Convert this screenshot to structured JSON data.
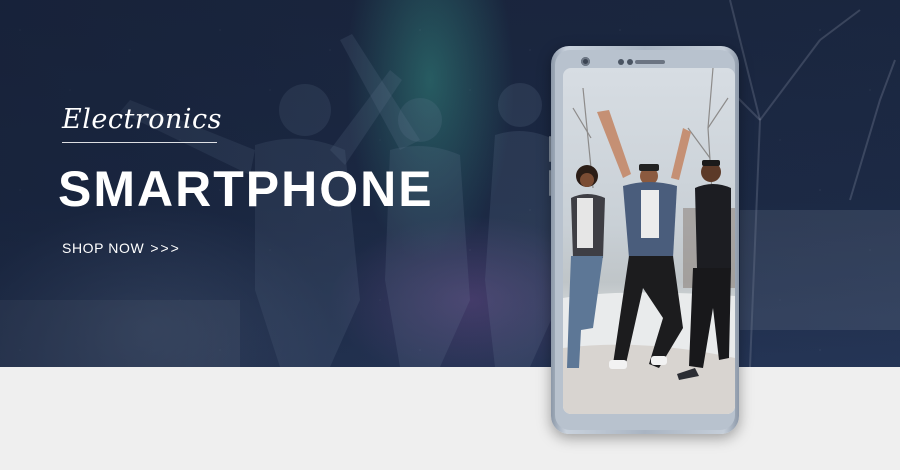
{
  "banner": {
    "category": "Electronics",
    "title": "SMARTPHONE",
    "cta": {
      "label": "SHOP NOW",
      "arrows": ">>>"
    }
  },
  "colors": {
    "hero_background": "#1d2b47",
    "aurora_green": "#3caa96",
    "aurora_purple": "#8c5aaa",
    "page_background": "#f0f0f0",
    "text": "#ffffff",
    "phone_frame": "#b8c2ce"
  },
  "icons": {
    "phone": "smartphone-mockup",
    "front_camera": "camera-icon"
  }
}
